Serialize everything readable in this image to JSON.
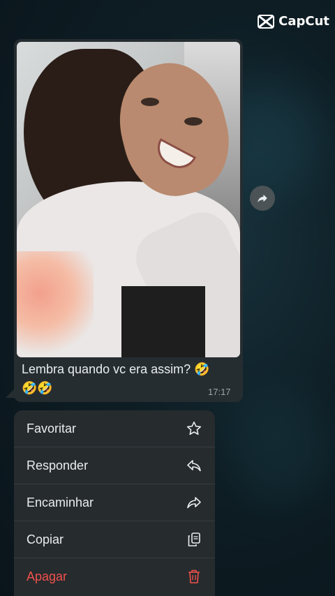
{
  "watermark": {
    "text": "CapCut"
  },
  "message": {
    "caption": "Lembra quando vc era assim? 🤣",
    "caption_line2": "🤣🤣",
    "time": "17:17"
  },
  "menu": {
    "items": [
      {
        "label": "Favoritar",
        "icon": "star-icon"
      },
      {
        "label": "Responder",
        "icon": "reply-icon"
      },
      {
        "label": "Encaminhar",
        "icon": "forward-icon"
      },
      {
        "label": "Copiar",
        "icon": "copy-icon"
      },
      {
        "label": "Apagar",
        "icon": "trash-icon"
      }
    ]
  },
  "colors": {
    "bubble": "#262d31",
    "menu_bg": "#262b2e",
    "danger": "#f1514b",
    "text": "#e9edef",
    "meta": "#9aa5ab"
  }
}
